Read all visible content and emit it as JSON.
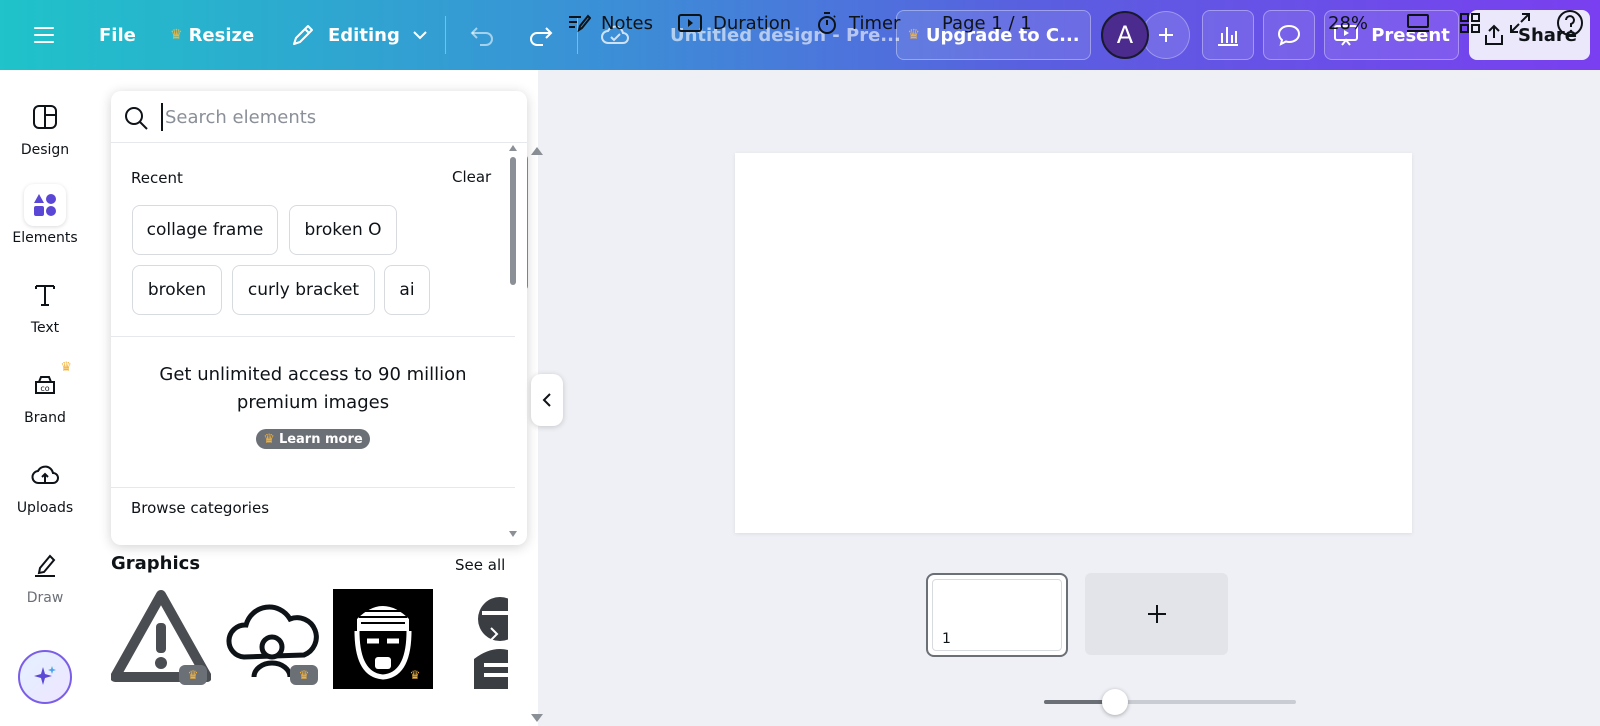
{
  "topbar": {
    "menu_icon": "hamburger-icon",
    "file_label": "File",
    "resize_label": "Resize",
    "editing_label": "Editing",
    "design_title": "Untitled design - Pre...",
    "upgrade_label": "Upgrade to C...",
    "avatar_letter": "A",
    "present_label": "Present",
    "share_label": "Share",
    "gradient_start": "#1fc3c9",
    "gradient_end": "#7a3ff0"
  },
  "rail": {
    "items": [
      {
        "label": "Design",
        "icon": "layout-icon"
      },
      {
        "label": "Elements",
        "icon": "shapes-icon"
      },
      {
        "label": "Text",
        "icon": "text-icon"
      },
      {
        "label": "Brand",
        "icon": "brand-icon"
      },
      {
        "label": "Uploads",
        "icon": "cloud-upload-icon"
      },
      {
        "label": "Draw",
        "icon": "draw-icon"
      }
    ],
    "accent": "#5b47d6"
  },
  "search": {
    "placeholder": "Search elements"
  },
  "recent": {
    "label": "Recent",
    "clear_label": "Clear",
    "chips": [
      "collage frame",
      "broken O",
      "broken",
      "curly bracket",
      "ai"
    ]
  },
  "promo": {
    "line1": "Get unlimited access to 90 million",
    "line2": "premium images",
    "learn_more": "Learn more"
  },
  "browse_label": "Browse categories",
  "graphics": {
    "title": "Graphics",
    "see_all": "See all"
  },
  "pages": {
    "current_page_number": "1"
  },
  "bottom": {
    "notes": "Notes",
    "duration": "Duration",
    "timer": "Timer",
    "page_indicator": "Page 1 / 1",
    "zoom": "28%",
    "zoom_fraction": 0.28
  }
}
